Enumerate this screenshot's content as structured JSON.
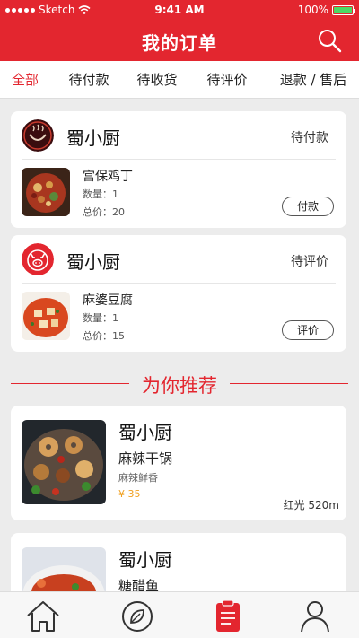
{
  "status_bar": {
    "carrier": "Sketch",
    "time": "9:41 AM",
    "battery": "100%"
  },
  "header": {
    "title": "我的订单"
  },
  "tabs": [
    {
      "label": "全部",
      "active": true
    },
    {
      "label": "待付款",
      "active": false
    },
    {
      "label": "待收货",
      "active": false
    },
    {
      "label": "待评价",
      "active": false
    },
    {
      "label": "退款 / 售后",
      "active": false
    }
  ],
  "orders": [
    {
      "shop": "蜀小厨",
      "status": "待付款",
      "dish": "宫保鸡丁",
      "qty": "数量：1",
      "total": "总价：20",
      "action": "付款"
    },
    {
      "shop": "蜀小厨",
      "status": "待评价",
      "dish": "麻婆豆腐",
      "qty": "数量：1",
      "total": "总价：15",
      "action": "评价"
    }
  ],
  "recommend": {
    "title": "为你推荐",
    "items": [
      {
        "shop": "蜀小厨",
        "dish": "麻辣干锅",
        "desc": "麻辣鲜香",
        "price": "¥ 35",
        "distance": "红光 520m"
      },
      {
        "shop": "蜀小厨",
        "dish": "糖醋鱼"
      }
    ]
  },
  "colors": {
    "brand": "#e3262f",
    "price": "#f0a020"
  }
}
